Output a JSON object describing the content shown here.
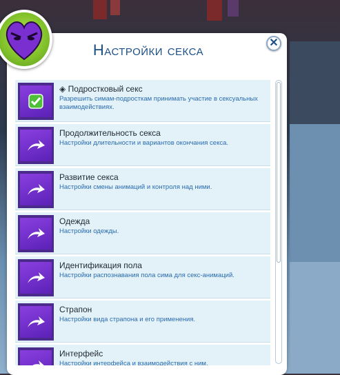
{
  "dialog": {
    "title": "Настройки секса",
    "close_icon": "close-icon",
    "badge_icon": "angry-heart-icon",
    "accent_color": "#1a4f88"
  },
  "items": [
    {
      "title": "◈ Подростковый секс",
      "description": "Разрешить симам-подросткам принимать участие в сексуальных взаимодействиях.",
      "icon": "checkbox-checked-icon"
    },
    {
      "title": "Продолжительность секса",
      "description": "Настройки длительности и вариантов окончания секса.",
      "icon": "arrow-right-icon"
    },
    {
      "title": "Развитие секса",
      "description": "Настройки смены анимаций и контроля над ними.",
      "icon": "arrow-right-icon"
    },
    {
      "title": "Одежда",
      "description": "Настройки одежды.",
      "icon": "arrow-right-icon"
    },
    {
      "title": "Идентификация пола",
      "description": "Настройки распознавания пола сима для секс-анимаций.",
      "icon": "arrow-right-icon"
    },
    {
      "title": "Страпон",
      "description": "Настройки вида страпона и его применения.",
      "icon": "arrow-right-icon"
    },
    {
      "title": "Интерфейс",
      "description": "Настройки интерфейса и взаимодействия с ним.",
      "icon": "arrow-right-icon"
    }
  ]
}
